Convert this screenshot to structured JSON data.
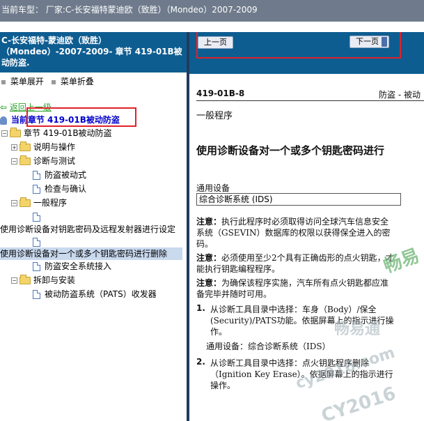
{
  "window": {
    "title_label": "当前车型：",
    "title_value": "厂家:C-长安福特蒙迪欧（致胜）（Mondeo）2007-2009"
  },
  "sidebar": {
    "header_lines": [
      "C-长安福特-蒙迪欧（致胜）",
      "（Mondeo）-2007-2009- 章节 419-01B被",
      "动防盗."
    ],
    "expand_menu": "菜单展开",
    "collapse_menu": "菜单折叠",
    "back_link": "返回上一级",
    "current_chapter": "当前章节 419-01B被动防盗",
    "tree": [
      {
        "label": "章节 419-01B被动防盗",
        "type": "folder",
        "toggle": "-"
      },
      {
        "label": "说明与操作",
        "type": "folder",
        "toggle": "+"
      },
      {
        "label": "诊断与测试",
        "type": "folder",
        "toggle": "-"
      },
      {
        "label": "防盗被动式",
        "type": "doc"
      },
      {
        "label": "检查与确认",
        "type": "doc"
      },
      {
        "label": "一般程序",
        "type": "folder",
        "toggle": "-"
      },
      {
        "label": "使用诊断设备对钥匙密码及远程发射器进行设定",
        "type": "doc"
      },
      {
        "label": "使用诊断设备对一个或多个钥匙密码进行删除",
        "type": "doc",
        "selected": true
      },
      {
        "label": "防盗安全系统接入",
        "type": "doc"
      },
      {
        "label": "拆卸与安装",
        "type": "folder",
        "toggle": "-"
      },
      {
        "label": "被动防盗系统（PATS）收发器",
        "type": "doc"
      }
    ]
  },
  "nav": {
    "prev_label": "上一页",
    "next_label": "下一页"
  },
  "document": {
    "section_code": "419-01B-8",
    "section_title": "防盗 - 被动",
    "category": "一般程序",
    "title": "使用诊断设备对一个或多个钥匙密码进行",
    "equipment_heading": "通用设备",
    "equipment_item": "综合诊断系统 (IDS)",
    "note1_label": "注意：",
    "note1_lines": [
      "执行此程序时必须取得访问全球汽车信息安全",
      "系统（GSEVIN）数据库的权限以获得保全进入的密",
      "码。"
    ],
    "note2_label": "注意：",
    "note2_lines": [
      "必须使用至少2个具有正确齿形的点火钥匙，才",
      "能执行钥匙编程程序。"
    ],
    "note3_label": "注意：",
    "note3_lines": [
      "为确保该程序实施，汽车所有点火钥匙都应准",
      "备完毕并随时可用。"
    ],
    "step1_num": "1.",
    "step1_lines": [
      "从诊断工具目录中选择：车身（Body）/保全",
      "(Security)/PATS功能。依据屏幕上的指示进行操",
      "作。"
    ],
    "step1_equipment": "通用设备：综合诊断系统（IDS）",
    "step2_num": "2.",
    "step2_lines": [
      "从诊断工具目录中选择：点火钥匙程序删除",
      "（Ignition Key Erase）。依据屏幕上的指示进行",
      "操作。"
    ]
  },
  "watermarks": {
    "wm1": "畅易通",
    "wm2": "畅易",
    "wm3": "cy2016.com",
    "wm4": "CY2016"
  },
  "colors": {
    "header_blue": "#0e5d91",
    "titlebar_gray": "#6f7b8c",
    "highlight_red": "#e0212a"
  }
}
